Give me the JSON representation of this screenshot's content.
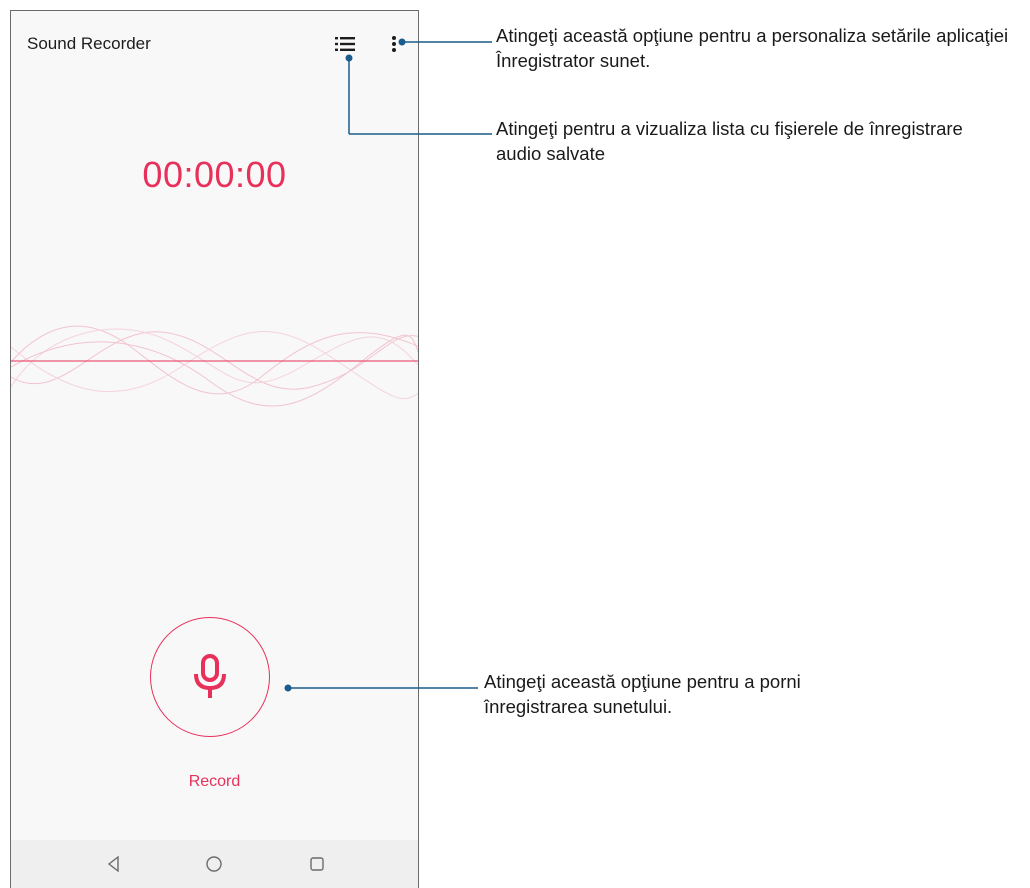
{
  "app": {
    "title": "Sound Recorder"
  },
  "timer": {
    "value": "00:00:00"
  },
  "record": {
    "label": "Record"
  },
  "toolbar": {
    "list_icon": "list-icon",
    "more_icon": "more-vert-icon"
  },
  "navbar": {
    "back_icon": "back-triangle-icon",
    "home_icon": "home-circle-icon",
    "recents_icon": "recents-square-icon"
  },
  "callouts": {
    "settings": "Atingeţi această opţiune pentru a personaliza setările aplicaţiei Înregistrator sunet.",
    "recordings_list": "Atingeţi pentru a vizualiza lista cu fişierele de înregistrare audio salvate",
    "record": "Atingeţi această opţiune pentru a porni înregistrarea sunetului."
  },
  "colors": {
    "accent": "#e7305a",
    "callout_line": "#1a5c8c",
    "background": "#f8f8f8",
    "navbar": "#efefef"
  }
}
